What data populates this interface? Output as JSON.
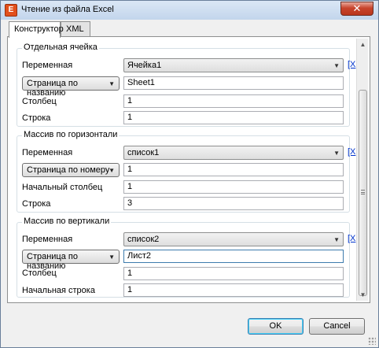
{
  "window": {
    "title": "Чтение из файла Excel",
    "close_glyph": "✕",
    "icon_glyph": "E"
  },
  "tabs": [
    {
      "label": "Конструктор",
      "active": true
    },
    {
      "label": "XML",
      "active": false
    }
  ],
  "groups": [
    {
      "title": "Отдельная ячейка",
      "variable_label": "Переменная",
      "variable_value": "Ячейка1",
      "remove_link": "[X",
      "page_mode": "Страница по названию",
      "page_value": "Sheet1",
      "row1_label": "Столбец",
      "row1_value": "1",
      "row2_label": "Строка",
      "row2_value": "1"
    },
    {
      "title": "Массив по горизонтали",
      "variable_label": "Переменная",
      "variable_value": "список1",
      "remove_link": "[X",
      "page_mode": "Страница по номеру",
      "page_value": "1",
      "row1_label": "Начальный столбец",
      "row1_value": "1",
      "row2_label": "Строка",
      "row2_value": "3"
    },
    {
      "title": "Массив по вертикали",
      "variable_label": "Переменная",
      "variable_value": "список2",
      "remove_link": "[X",
      "page_mode": "Страница по названию",
      "page_value": "Лист2",
      "row1_label": "Столбец",
      "row1_value": "1",
      "row2_label": "Начальная строка",
      "row2_value": "1"
    }
  ],
  "buttons": {
    "ok": "OK",
    "cancel": "Cancel"
  },
  "icons": {
    "dropdown": "▼",
    "scroll_up": "▲",
    "scroll_down": "▼"
  }
}
